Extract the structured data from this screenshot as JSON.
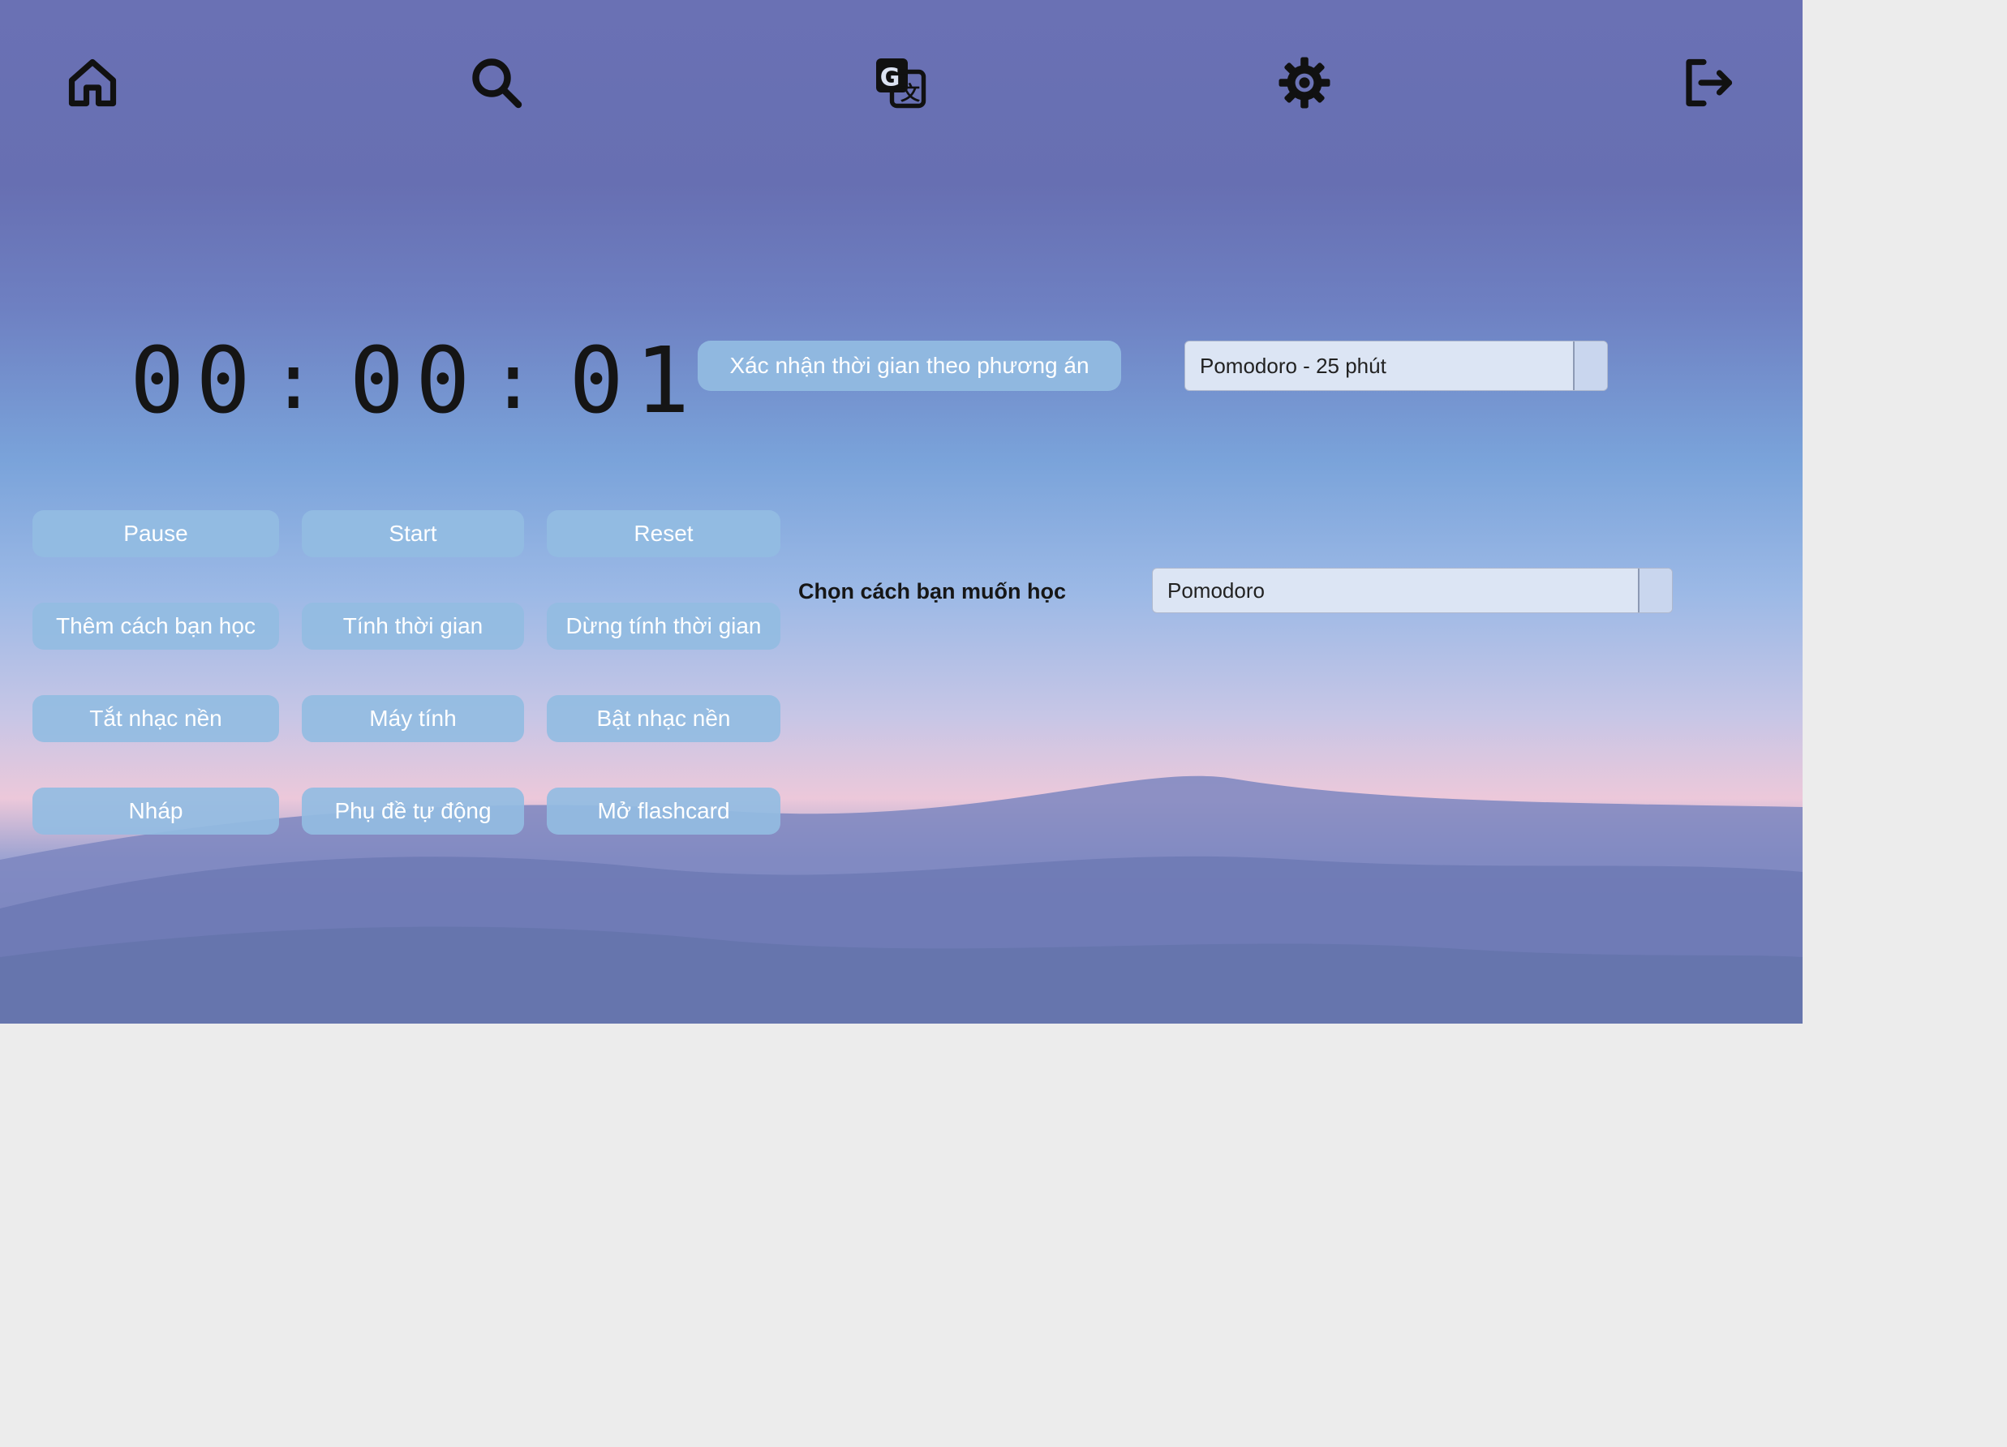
{
  "nav": {
    "icons": [
      "home-icon",
      "search-icon",
      "translate-icon",
      "gear-icon",
      "logout-icon"
    ]
  },
  "timer": {
    "hours": "00",
    "minutes": "00",
    "seconds": "01",
    "separator": ":"
  },
  "confirm_button": {
    "label": "Xác nhận thời gian theo phương án"
  },
  "duration_select": {
    "value": "Pomodoro - 25 phút"
  },
  "method": {
    "label": "Chọn cách bạn muốn học",
    "value": "Pomodoro"
  },
  "buttons": {
    "pause": "Pause",
    "start": "Start",
    "reset": "Reset",
    "add_method": "Thêm cách bạn học",
    "stopwatch": "Tính thời gian",
    "stop_stopwatch": "Dừng tính thời gian",
    "music_off": "Tắt nhạc nền",
    "calculator": "Máy tính",
    "music_on": "Bật nhạc nền",
    "draft": "Nháp",
    "auto_subtitles": "Phụ đề tự động",
    "open_flashcard": "Mở flashcard"
  },
  "colors": {
    "button_bg": "#93bce2",
    "button_text": "#ffffff",
    "sky_top": "#6a71b4",
    "dune": "#6a79b5"
  }
}
